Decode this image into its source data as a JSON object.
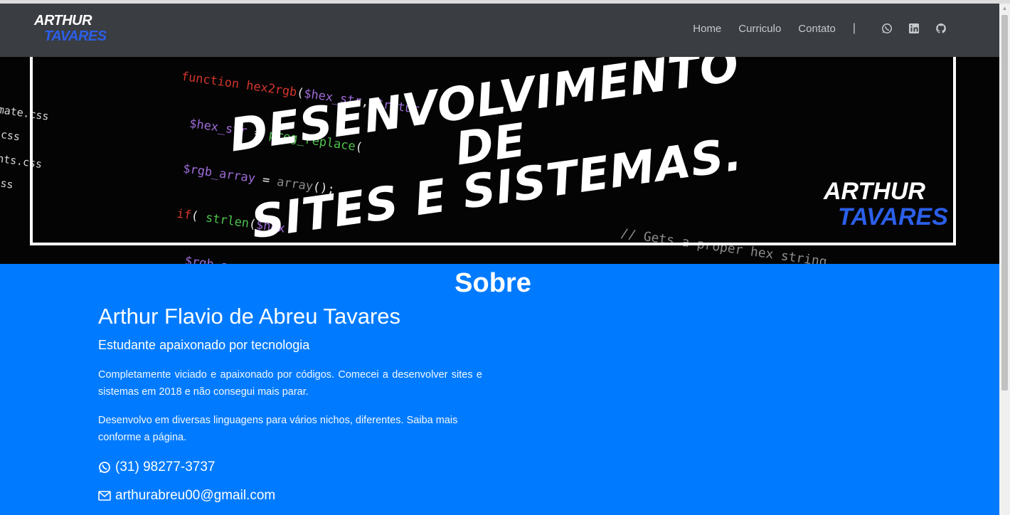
{
  "brand": {
    "line1": "ARTHUR",
    "line2": "TAVARES"
  },
  "nav": {
    "items": [
      {
        "label": "Home"
      },
      {
        "label": "Curriculo"
      },
      {
        "label": "Contato"
      }
    ],
    "separator": "|",
    "social_icons": [
      "whatsapp-icon",
      "linkedin-icon",
      "github-icon"
    ]
  },
  "banner": {
    "headline_line1": "DESENVOLVIMENTO DE",
    "headline_line2": "SITES E SISTEMAS.",
    "logo_line1": "ARTHUR",
    "logo_line2": "TAVARES"
  },
  "about": {
    "title": "Sobre",
    "name": "Arthur Flavio de Abreu Tavares",
    "subtitle": "Estudante apaixonado por tecnologia",
    "paragraph1": "Completamente viciado e apaixonado por códigos. Comecei a desenvolver sites e sistemas em 2018 e não consegui mais parar.",
    "paragraph2": "Desenvolvo em diversas linguagens para vários nichos, diferentes. Saiba mais conforme a página.",
    "phone": "(31) 98277-3737",
    "email": "arthurabreu00@gmail.com"
  },
  "colors": {
    "navbar_bg": "#3a3d42",
    "accent_blue": "#007bff",
    "brand_blue": "#2b5fe8"
  }
}
